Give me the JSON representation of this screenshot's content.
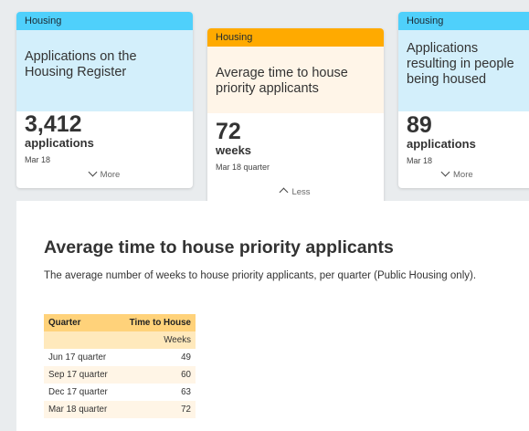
{
  "cards": [
    {
      "tag": "Housing",
      "heading": "Applications on the Housing Register",
      "value": "3,412",
      "unit": "applications",
      "date": "Mar 18",
      "toggle": "More"
    },
    {
      "tag": "Housing",
      "heading": "Average time to house priority applicants",
      "value": "72",
      "unit": "weeks",
      "date": "Mar 18 quarter",
      "toggle": "Less"
    },
    {
      "tag": "Housing",
      "heading": "Applications resulting in people being housed",
      "value": "89",
      "unit": "applications",
      "date": "Mar 18",
      "toggle": "More"
    }
  ],
  "detail": {
    "title": "Average time to house priority applicants",
    "description": "The average number of weeks to house priority applicants, per quarter (Public Housing only).",
    "table": {
      "headers": [
        "Quarter",
        "Time to House"
      ],
      "unit_row": "Weeks",
      "rows": [
        {
          "quarter": "Jun 17 quarter",
          "value": "49"
        },
        {
          "quarter": "Sep 17 quarter",
          "value": "60"
        },
        {
          "quarter": "Dec 17 quarter",
          "value": "63"
        },
        {
          "quarter": "Mar 18 quarter",
          "value": "72"
        }
      ]
    }
  },
  "colors": {
    "housing_blue": "#4fd0fb",
    "housing_orange": "#ffaa00",
    "table_header": "#ffd27a"
  }
}
